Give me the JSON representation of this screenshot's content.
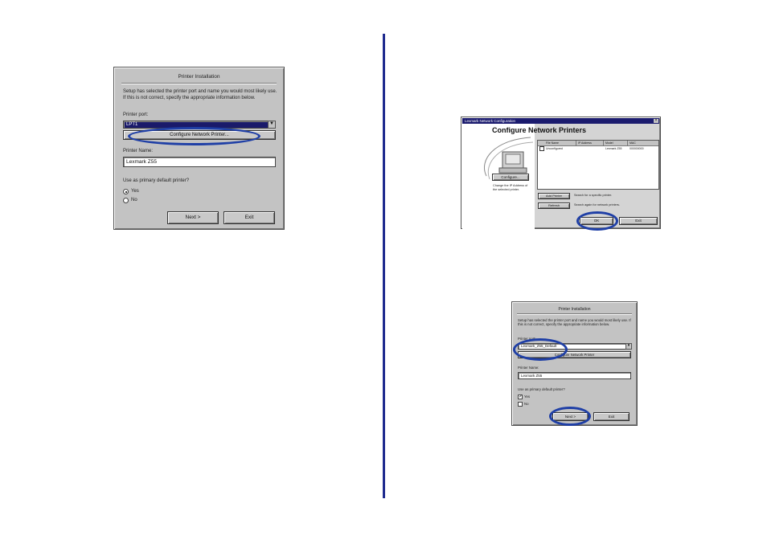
{
  "dialog1": {
    "title": "Printer Installation",
    "description": "Setup has selected the printer port and name you would most likely use. If this is not correct, specify the appropriate information below.",
    "printer_port_label": "Printer port:",
    "printer_port_value": "LPT1",
    "configure_button": "Configure Network Printer...",
    "printer_name_label": "Printer Name:",
    "printer_name_value": "Lexmark Z55",
    "default_question": "Use as primary default printer?",
    "yes_label": "Yes",
    "no_label": "No",
    "next_button": "Next >",
    "exit_button": "Exit"
  },
  "dialog2": {
    "titlebar": "Lexmark Network Configuration",
    "heading": "Configure Network Printers",
    "columns": [
      "File Name",
      "IP Address",
      "Model",
      "MAC"
    ],
    "rows": [
      [
        "Unconfigured",
        "",
        "Lexmark Z55",
        "000000000"
      ]
    ],
    "configure_button": "Configure...",
    "configure_note": "Change the IP Address of the selected printer.",
    "search_button": "Add Printer",
    "search_note": "Search for a specific printer.",
    "refresh_button": "Refresh",
    "refresh_note": "Search again for network printers.",
    "ok_button": "OK",
    "exit_button": "Exit",
    "close_glyph": "×"
  },
  "dialog3": {
    "title": "Printer Installation",
    "description": "Setup has selected the printer port and name you would most likely use. If this is not correct, specify the appropriate information below.",
    "printer_port_label": "Printer port:",
    "printer_port_value": "Lexmark_Z55_Default",
    "configure_button": "Configure Network Printer",
    "printer_name_label": "Printer Name:",
    "printer_name_value": "Lexmark Z55",
    "default_question": "Use as primary default printer?",
    "yes_label": "Yes",
    "no_label": "No",
    "next_button": "Next >",
    "exit_button": "Exit"
  },
  "colors": {
    "highlight_ellipse": "#1f3fa6",
    "divider": "#1f2b8f",
    "dialog_bg": "#c3c3c3"
  }
}
